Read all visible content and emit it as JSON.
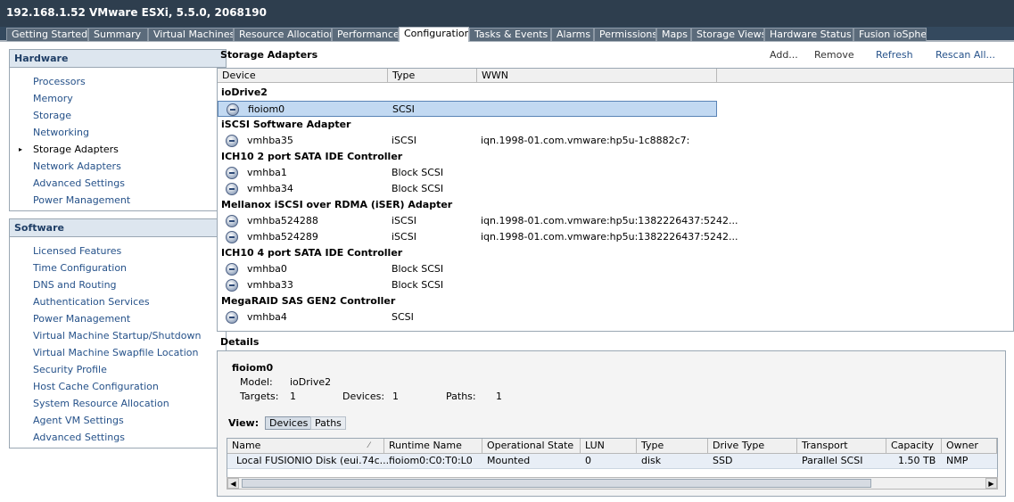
{
  "window": {
    "title": "192.168.1.52 VMware ESXi, 5.5.0, 2068190"
  },
  "tabs": [
    {
      "label": "Getting Started"
    },
    {
      "label": "Summary"
    },
    {
      "label": "Virtual Machines"
    },
    {
      "label": "Resource Allocation"
    },
    {
      "label": "Performance"
    },
    {
      "label": "Configuration"
    },
    {
      "label": "Tasks & Events"
    },
    {
      "label": "Alarms"
    },
    {
      "label": "Permissions"
    },
    {
      "label": "Maps"
    },
    {
      "label": "Storage Views"
    },
    {
      "label": "Hardware Status"
    },
    {
      "label": "Fusion ioSphere"
    }
  ],
  "active_tab": "Configuration",
  "hardware": {
    "title": "Hardware",
    "items": [
      {
        "label": "Processors"
      },
      {
        "label": "Memory"
      },
      {
        "label": "Storage"
      },
      {
        "label": "Networking"
      },
      {
        "label": "Storage Adapters"
      },
      {
        "label": "Network Adapters"
      },
      {
        "label": "Advanced Settings"
      },
      {
        "label": "Power Management"
      }
    ],
    "selected": "Storage Adapters"
  },
  "software": {
    "title": "Software",
    "items": [
      {
        "label": "Licensed Features"
      },
      {
        "label": "Time Configuration"
      },
      {
        "label": "DNS and Routing"
      },
      {
        "label": "Authentication Services"
      },
      {
        "label": "Power Management"
      },
      {
        "label": "Virtual Machine Startup/Shutdown"
      },
      {
        "label": "Virtual Machine Swapfile Location"
      },
      {
        "label": "Security Profile"
      },
      {
        "label": "Host Cache Configuration"
      },
      {
        "label": "System Resource Allocation"
      },
      {
        "label": "Agent VM Settings"
      },
      {
        "label": "Advanced Settings"
      }
    ]
  },
  "storage_adapters": {
    "title": "Storage Adapters",
    "actions": {
      "add": "Add...",
      "remove": "Remove",
      "refresh": "Refresh",
      "rescan": "Rescan All..."
    },
    "columns": {
      "device": "Device",
      "type": "Type",
      "wwn": "WWN"
    },
    "groups": [
      {
        "name": "ioDrive2",
        "adapters": [
          {
            "device": "fioiom0",
            "type": "SCSI",
            "wwn": "",
            "selected": true
          }
        ]
      },
      {
        "name": "iSCSI Software Adapter",
        "adapters": [
          {
            "device": "vmhba35",
            "type": "iSCSI",
            "wwn": "iqn.1998-01.com.vmware:hp5u-1c8882c7:"
          }
        ]
      },
      {
        "name": "ICH10 2 port SATA IDE Controller",
        "adapters": [
          {
            "device": "vmhba1",
            "type": "Block SCSI",
            "wwn": ""
          },
          {
            "device": "vmhba34",
            "type": "Block SCSI",
            "wwn": ""
          }
        ]
      },
      {
        "name": "Mellanox iSCSI over RDMA (iSER) Adapter",
        "adapters": [
          {
            "device": "vmhba524288",
            "type": "iSCSI",
            "wwn": "iqn.1998-01.com.vmware:hp5u:1382226437:5242..."
          },
          {
            "device": "vmhba524289",
            "type": "iSCSI",
            "wwn": "iqn.1998-01.com.vmware:hp5u:1382226437:5242..."
          }
        ]
      },
      {
        "name": "ICH10 4 port SATA IDE Controller",
        "adapters": [
          {
            "device": "vmhba0",
            "type": "Block SCSI",
            "wwn": ""
          },
          {
            "device": "vmhba33",
            "type": "Block SCSI",
            "wwn": ""
          }
        ]
      },
      {
        "name": "MegaRAID SAS GEN2 Controller",
        "adapters": [
          {
            "device": "vmhba4",
            "type": "SCSI",
            "wwn": ""
          }
        ]
      }
    ]
  },
  "details": {
    "title": "Details",
    "device_name": "fioiom0",
    "model_label": "Model:",
    "model_value": "ioDrive2",
    "targets_label": "Targets:",
    "targets_value": "1",
    "devices_label": "Devices:",
    "devices_value": "1",
    "paths_label": "Paths:",
    "paths_value": "1",
    "view_label": "View:",
    "view_devices": "Devices",
    "view_paths": "Paths",
    "table": {
      "columns": [
        "Name",
        "Runtime Name",
        "Operational State",
        "LUN",
        "Type",
        "Drive Type",
        "Transport",
        "Capacity",
        "Owner"
      ],
      "rows": [
        [
          "Local FUSIONIO Disk (eui.74c...",
          "fioiom0:C0:T0:L0",
          "Mounted",
          "0",
          "disk",
          "SSD",
          "Parallel SCSI",
          "1.50 TB",
          "NMP"
        ]
      ]
    }
  },
  "colors": {
    "title_bar": "#2e3e4e",
    "tab_strip": "#34495e",
    "link": "#26528a",
    "panel_header": "#dde6ef",
    "selection": "#c2d9f2"
  }
}
